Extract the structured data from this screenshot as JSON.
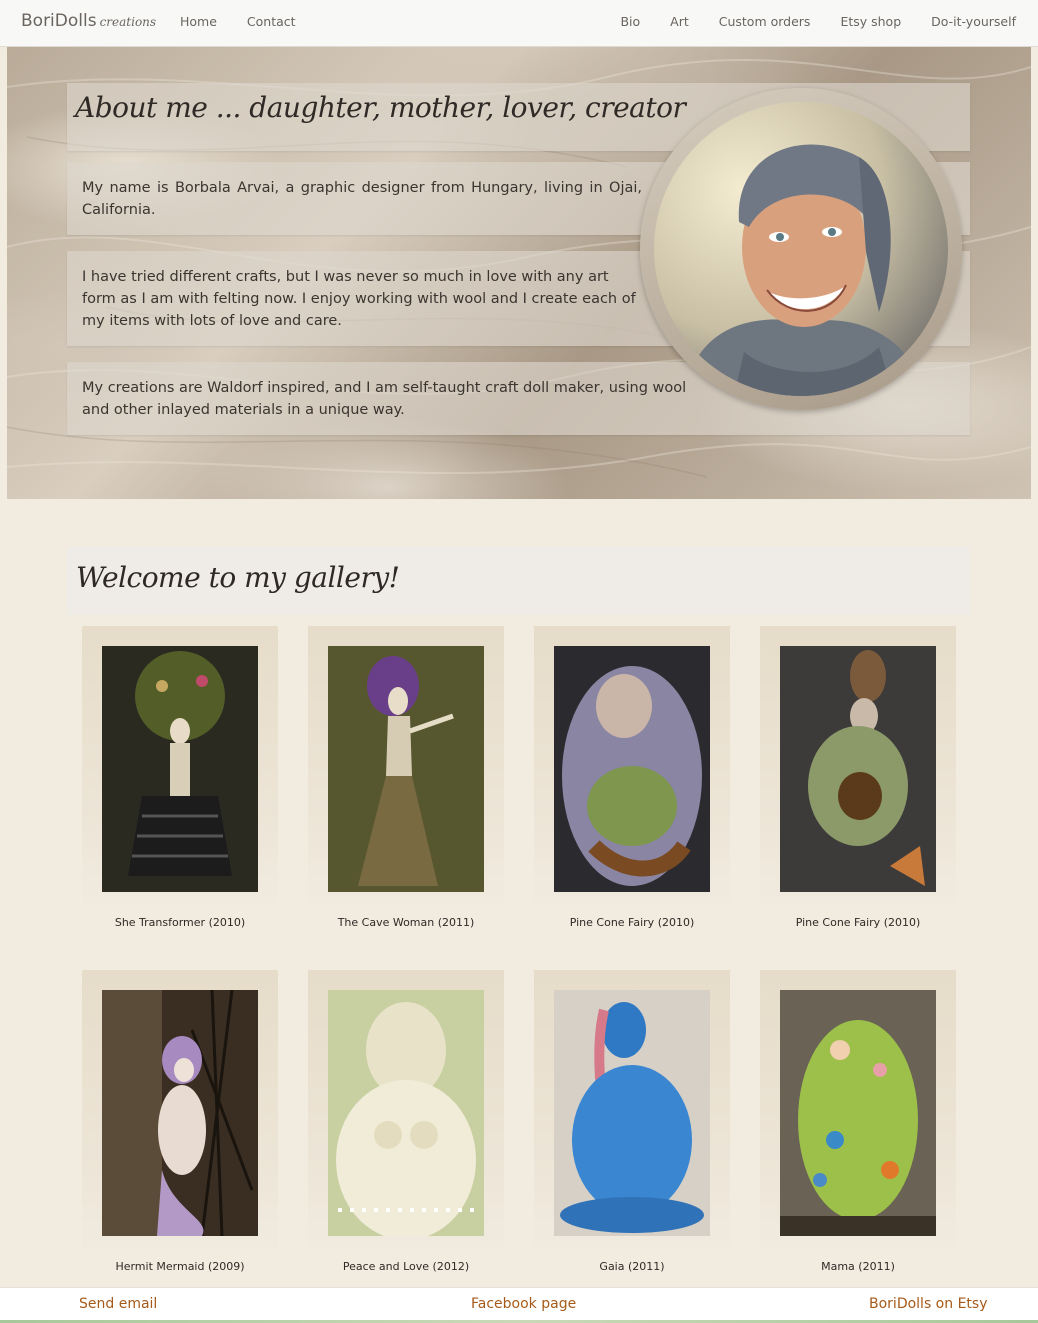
{
  "navbar": {
    "brand": "BoriDolls",
    "brand_suffix": "creations",
    "left_items": [
      "Home",
      "Contact"
    ],
    "right_items": [
      "Bio",
      "Art",
      "Custom orders",
      "Etsy shop",
      "Do-it-yourself"
    ]
  },
  "about": {
    "title": "About me ... daughter, mother, lover, creator",
    "p1": "My name is Borbala Arvai, a graphic designer from Hungary, living in Ojai, California.",
    "p2": "I have tried different crafts, but I was never so much in love with any art form as I am with felting now. I enjoy working with wool and I create each of my items with lots of love and care.",
    "p3": "My creations are Waldorf inspired, and I am self-taught craft doll maker, using wool and other inlayed materials in a unique way."
  },
  "gallery": {
    "title": "Welcome to my gallery!",
    "items": [
      {
        "caption": "She Transformer (2010)"
      },
      {
        "caption": "The Cave Woman (2011)"
      },
      {
        "caption": "Pine Cone Fairy (2010)"
      },
      {
        "caption": "Pine Cone Fairy (2010)"
      },
      {
        "caption": "Hermit Mermaid (2009)"
      },
      {
        "caption": "Peace and Love (2012)"
      },
      {
        "caption": "Gaia (2011)"
      },
      {
        "caption": "Mama (2011)"
      }
    ]
  },
  "footer": {
    "send_email": "Send email",
    "facebook": "Facebook page",
    "etsy": "BoriDolls on Etsy",
    "link_color": "#a65a1a"
  }
}
